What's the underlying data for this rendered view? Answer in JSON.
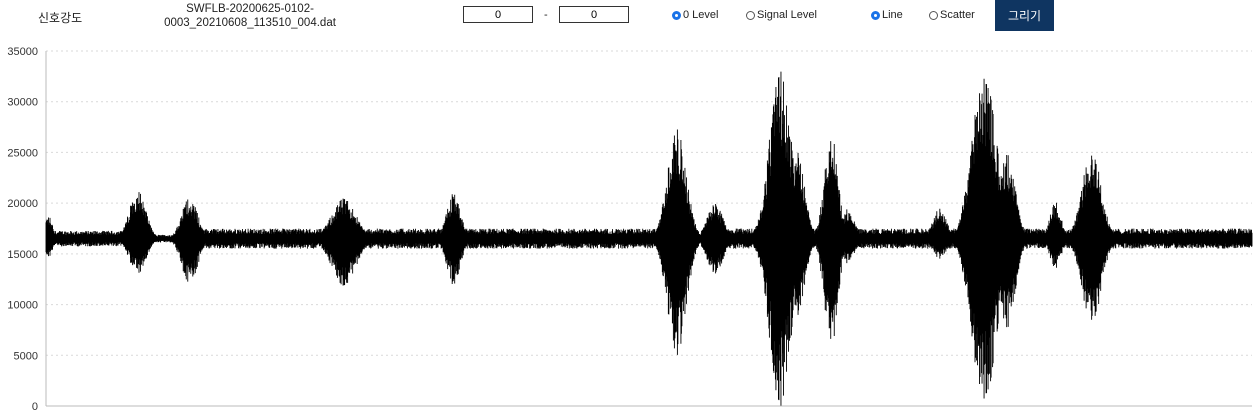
{
  "toolbar": {
    "title": "신호강도",
    "filename_line1": "SWFLB-20200625-0102-",
    "filename_line2": "0003_20210608_113510_004.dat",
    "range_start": "0",
    "range_separator": "-",
    "range_end": "0",
    "level_options": [
      {
        "label": "0 Level",
        "selected": true
      },
      {
        "label": "Signal Level",
        "selected": false
      }
    ],
    "plot_options": [
      {
        "label": "Line",
        "selected": true
      },
      {
        "label": "Scatter",
        "selected": false
      }
    ],
    "draw_button": "그리기"
  },
  "colors": {
    "button_bg": "#0f3561",
    "series": "#000000",
    "grid": "#d9d9d9",
    "radio_selected": "#1a73e8"
  },
  "chart_data": {
    "type": "line",
    "ylim": [
      0,
      35000
    ],
    "y_ticks": [
      "0",
      "5000",
      "10000",
      "15000",
      "20000",
      "25000",
      "30000",
      "35000"
    ],
    "grid": "horizontal dotted",
    "baseline": 16500,
    "noise_segments": [
      {
        "start": 0.0,
        "end": 0.075,
        "amp": 700
      },
      {
        "start": 0.075,
        "end": 0.115,
        "amp": 350
      },
      {
        "start": 0.115,
        "end": 0.505,
        "amp": 900
      },
      {
        "start": 0.505,
        "end": 0.56,
        "amp": 280
      },
      {
        "start": 0.56,
        "end": 1.0,
        "amp": 900
      }
    ],
    "bursts": [
      {
        "pos": 0.002,
        "max": 18800,
        "min": 14600,
        "width": 0.006
      },
      {
        "pos": 0.076,
        "max": 21400,
        "min": 12900,
        "width": 0.012
      },
      {
        "pos": 0.119,
        "max": 20600,
        "min": 12000,
        "width": 0.012
      },
      {
        "pos": 0.247,
        "max": 20500,
        "min": 11800,
        "width": 0.018
      },
      {
        "pos": 0.338,
        "max": 21000,
        "min": 11900,
        "width": 0.01
      },
      {
        "pos": 0.523,
        "max": 27300,
        "min": 5000,
        "width": 0.014
      },
      {
        "pos": 0.555,
        "max": 20000,
        "min": 13000,
        "width": 0.012
      },
      {
        "pos": 0.609,
        "max": 33000,
        "min": 0,
        "width": 0.016
      },
      {
        "pos": 0.622,
        "max": 25500,
        "min": 8500,
        "width": 0.012
      },
      {
        "pos": 0.651,
        "max": 27000,
        "min": 5700,
        "width": 0.01
      },
      {
        "pos": 0.665,
        "max": 19500,
        "min": 14000,
        "width": 0.01
      },
      {
        "pos": 0.741,
        "max": 19500,
        "min": 14500,
        "width": 0.01
      },
      {
        "pos": 0.778,
        "max": 33000,
        "min": 0,
        "width": 0.018
      },
      {
        "pos": 0.797,
        "max": 25000,
        "min": 7500,
        "width": 0.012
      },
      {
        "pos": 0.837,
        "max": 20200,
        "min": 13500,
        "width": 0.008
      },
      {
        "pos": 0.867,
        "max": 25400,
        "min": 7800,
        "width": 0.014
      }
    ]
  }
}
